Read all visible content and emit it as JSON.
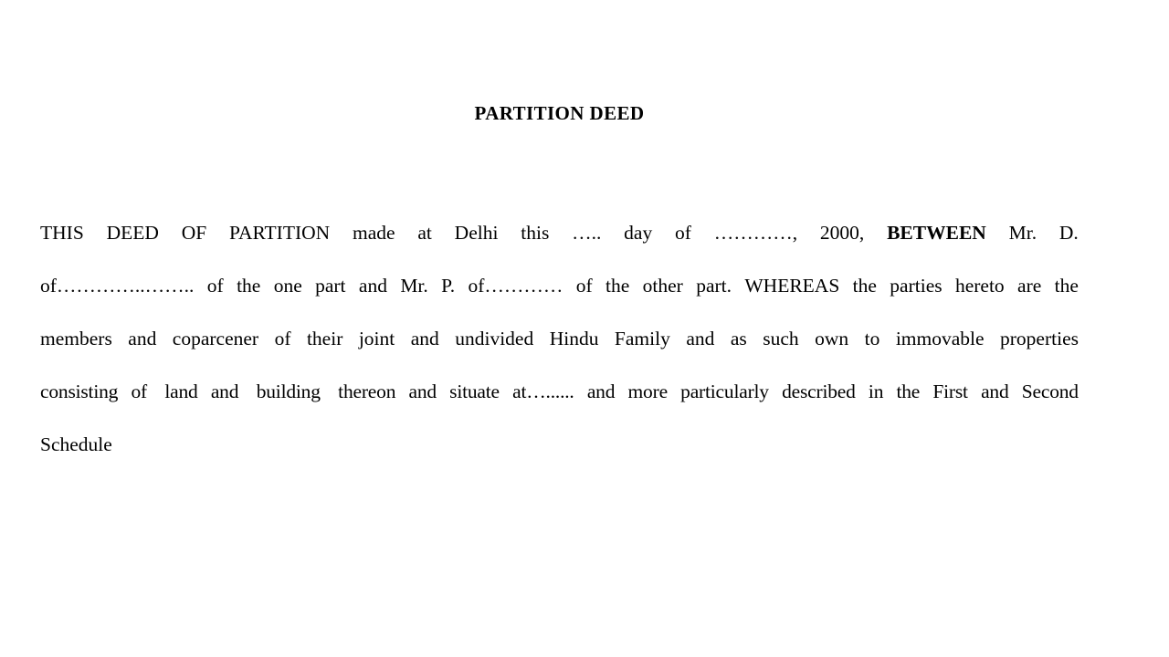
{
  "document": {
    "title": "PARTITION DEED",
    "background_color": "#ffffff",
    "text_color": "#000000",
    "paragraph_lines": [
      {
        "id": "line-1",
        "justified": true,
        "words": [
          "THIS",
          "DEED",
          "OF",
          "PARTITION",
          "made",
          "at",
          "Delhi",
          "this",
          "…..",
          "day",
          "of",
          "…………,",
          "2000,",
          "BETWEEN",
          "Mr.",
          "D."
        ],
        "bold_words": [
          "BETWEEN"
        ],
        "full_text": "THIS DEED OF PARTITION made at Delhi this ….. day of …………, 2000, BETWEEN Mr. D."
      },
      {
        "id": "line-2",
        "justified": true,
        "words": [
          "of…………..……..",
          "of",
          "the",
          "one",
          "part",
          "and",
          "Mr.",
          "P.",
          "of…………",
          "of",
          "the",
          "other",
          "part.",
          "WHEREAS",
          "the",
          "parties",
          "hereto",
          "are",
          "the"
        ],
        "bold_words": [],
        "full_text": "of…………..…….. of the one part and Mr. P. of………… of the other part. WHEREAS the parties hereto are the"
      },
      {
        "id": "line-3",
        "justified": true,
        "words": [
          "members",
          "and",
          "coparcener",
          "of",
          "their",
          "joint",
          "and",
          "undivided",
          "Hindu",
          "Family",
          "and",
          "as",
          "such",
          "own",
          "to",
          "immovable",
          "properties"
        ],
        "bold_words": [],
        "full_text": "members and coparcener of their joint and undivided Hindu Family and as such own to immovable properties"
      },
      {
        "id": "line-4",
        "justified": true,
        "words": [
          "consisting",
          "of",
          " land",
          "and",
          " building",
          " thereon",
          "and",
          "situate",
          "at…......",
          "and",
          "more",
          "particularly",
          "described",
          "in",
          "the",
          "First",
          "and",
          "Second"
        ],
        "bold_words": [],
        "full_text": "consisting of  land and  building  thereon and situate at…...... and more particularly described in the First and Second"
      },
      {
        "id": "line-5",
        "justified": false,
        "words": [
          "Schedule"
        ],
        "bold_words": [],
        "full_text": "Schedule"
      }
    ]
  }
}
